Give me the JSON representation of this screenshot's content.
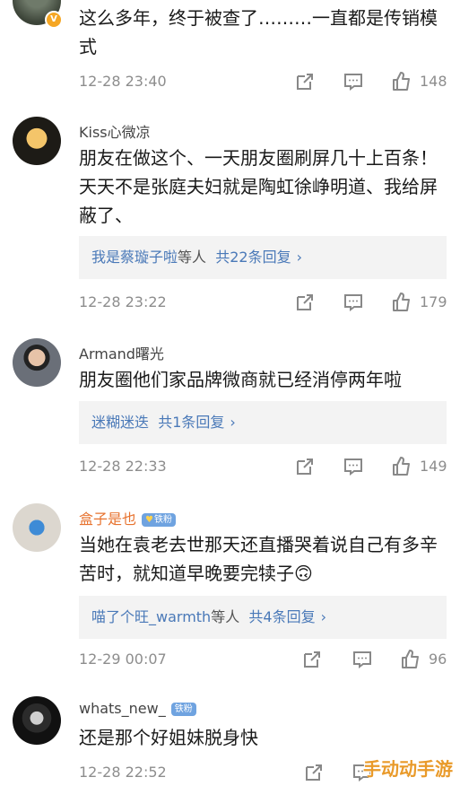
{
  "comments": [
    {
      "name": "",
      "text": "这么多年，终于被查了………一直都是传销模式",
      "time": "12-28 23:40",
      "likes": "148",
      "verified_badge": "vip-v-icon"
    },
    {
      "name": "Kiss心微凉",
      "text": "朋友在做这个、一天朋友圈刷屏几十上百条！天天不是张庭夫妇就是陶虹徐峥明道、我给屏蔽了、",
      "reply_users": "我是蔡璇子啦",
      "reply_mid": "等人",
      "reply_count": "共22条回复",
      "time": "12-28 23:22",
      "likes": "179"
    },
    {
      "name": "Armand曙光",
      "text": "朋友圈他们家品牌微商就已经消停两年啦",
      "reply_users": "迷糊迷迭",
      "reply_mid": "",
      "reply_count": "共1条回复",
      "time": "12-28 22:33",
      "likes": "149"
    },
    {
      "name": "盒子是也",
      "fan_badge": "铁粉",
      "text": "当她在袁老去世那天还直播哭着说自己有多辛苦时，就知道早晚要完犊子🙃",
      "reply_users": "喵了个旺_warmth",
      "reply_mid": "等人",
      "reply_count": "共4条回复",
      "time": "12-29 00:07",
      "likes": "96"
    },
    {
      "name": "whats_new_",
      "fan_badge": "铁粉",
      "text": "还是那个好姐妹脱身快",
      "time": "12-28 22:52",
      "likes": ""
    }
  ],
  "watermark": "手动动手游",
  "colors": {
    "link_blue": "#4a79b8",
    "name_orange": "#e7722e",
    "fan_badge_blue": "#6fa3e0",
    "meta_gray": "#8d8d8d"
  },
  "icons": [
    "share-icon",
    "comment-icon",
    "thumbs-up-icon"
  ]
}
